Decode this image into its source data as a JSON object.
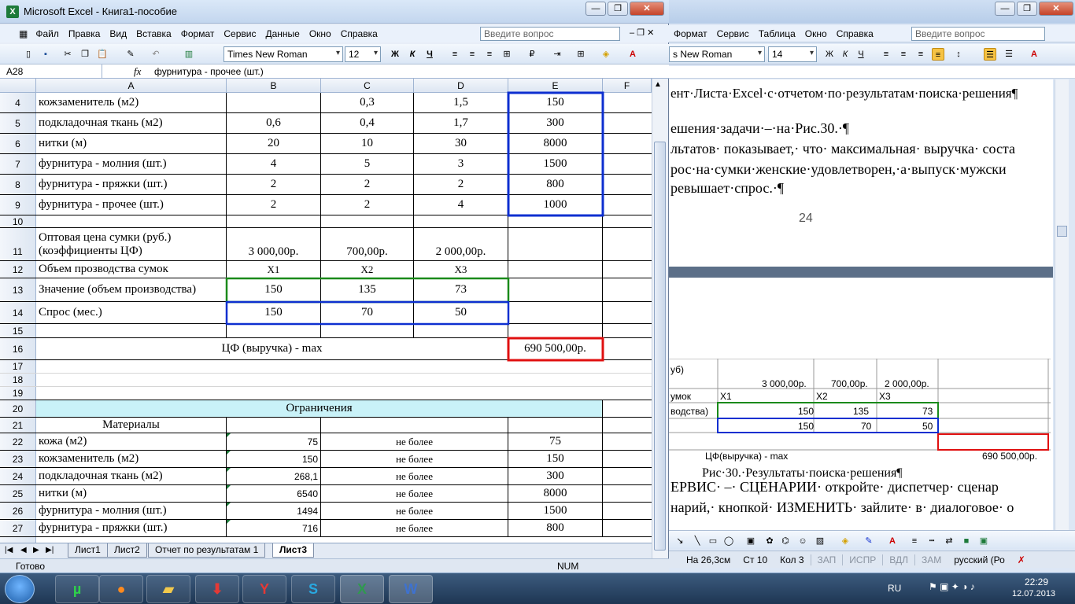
{
  "excel": {
    "title": "Microsoft Excel - Книга1-пособие",
    "menu": [
      "Файл",
      "Правка",
      "Вид",
      "Вставка",
      "Формат",
      "Сервис",
      "Данные",
      "Окно",
      "Справка"
    ],
    "ask_placeholder": "Введите вопрос",
    "font": "Times New Roman",
    "font_size": "12",
    "bold": "Ж",
    "italic": "К",
    "underline": "Ч",
    "namebox": "A28",
    "fx": "fx",
    "formula": "фурнитура - прочее (шт.)",
    "columns": [
      "A",
      "B",
      "C",
      "D",
      "E",
      "F"
    ],
    "rows": {
      "r4": {
        "n": "4",
        "a": "кожзаменитель (м2)",
        "b": "",
        "c": "0,3",
        "d": "1,5",
        "e": "150"
      },
      "r5": {
        "n": "5",
        "a": "подкладочная ткань (м2)",
        "b": "0,6",
        "c": "0,4",
        "d": "1,7",
        "e": "300"
      },
      "r6": {
        "n": "6",
        "a": "нитки (м)",
        "b": "20",
        "c": "10",
        "d": "30",
        "e": "8000"
      },
      "r7": {
        "n": "7",
        "a": "фурнитура - молния (шт.)",
        "b": "4",
        "c": "5",
        "d": "3",
        "e": "1500"
      },
      "r8": {
        "n": "8",
        "a": "фурнитура - пряжки (шт.)",
        "b": "2",
        "c": "2",
        "d": "2",
        "e": "800"
      },
      "r9": {
        "n": "9",
        "a": "фурнитура - прочее (шт.)",
        "b": "2",
        "c": "2",
        "d": "4",
        "e": "1000"
      },
      "r10": {
        "n": "10"
      },
      "r11": {
        "n": "11",
        "a1": "Оптовая цена сумки (руб.)",
        "a2": "(коэффициенты ЦФ)",
        "b": "3 000,00р.",
        "c": "700,00р.",
        "d": "2 000,00р."
      },
      "r12": {
        "n": "12",
        "a": "Объем прозводства сумок",
        "b": "X1",
        "c": "X2",
        "d": "X3"
      },
      "r13": {
        "n": "13",
        "a": "Значение (объем производства)",
        "b": "150",
        "c": "135",
        "d": "73"
      },
      "r14": {
        "n": "14",
        "a": "Спрос (мес.)",
        "b": "150",
        "c": "70",
        "d": "50"
      },
      "r15": {
        "n": "15"
      },
      "r16": {
        "n": "16",
        "label": "ЦФ (выручка) - max",
        "e": "690 500,00р."
      },
      "r17": {
        "n": "17"
      },
      "r18": {
        "n": "18"
      },
      "r19": {
        "n": "19"
      },
      "r20": {
        "n": "20",
        "label": "Ограничения"
      },
      "r21": {
        "n": "21",
        "a": "Материалы"
      },
      "r22": {
        "n": "22",
        "a": "кожа (м2)",
        "b": "75",
        "c": "не более",
        "e": "75"
      },
      "r23": {
        "n": "23",
        "a": "кожзаменитель (м2)",
        "b": "150",
        "c": "не более",
        "e": "150"
      },
      "r24": {
        "n": "24",
        "a": "подкладочная ткань (м2)",
        "b": "268,1",
        "c": "не более",
        "e": "300"
      },
      "r25": {
        "n": "25",
        "a": "нитки (м)",
        "b": "6540",
        "c": "не более",
        "e": "8000"
      },
      "r26": {
        "n": "26",
        "a": "фурнитура - молния (шт.)",
        "b": "1494",
        "c": "не более",
        "e": "1500"
      },
      "r27": {
        "n": "27",
        "a": "фурнитура - пряжки (шт.)",
        "b": "716",
        "c": "не более",
        "e": "800"
      }
    },
    "sheets": [
      "Лист1",
      "Лист2",
      "Отчет по результатам 1",
      "Лист3"
    ],
    "status": "Готово",
    "num": "NUM"
  },
  "word": {
    "menu": [
      "Формат",
      "Сервис",
      "Таблица",
      "Окно",
      "Справка"
    ],
    "ask_placeholder": "Введите вопрос",
    "font": "s New Roman",
    "font_size": "14",
    "lines": [
      "ент·Листа·Excel·с·отчетом·по·результатам·поиска·решения¶",
      "ешения·задачи·–·на·Рис.30.·¶",
      "льтатов· показывает,· что· максимальная· выручка· соста",
      "рос·на·сумки·женские·удовлетворен,·а·выпуск·мужски",
      "ревышает·спрос.·¶"
    ],
    "page_number": "24",
    "table": {
      "r1a": "уб)",
      "r2b": "3 000,00р.",
      "r2c": "700,00р.",
      "r2d": "2 000,00р.",
      "r3a": "умок",
      "r3b": "X1",
      "r3c": "X2",
      "r3d": "X3",
      "r4a": "водства)",
      "r4b": "150",
      "r4c": "135",
      "r4d": "73",
      "r5b": "150",
      "r5c": "70",
      "r5d": "50",
      "r6a": "ЦФ(выручка) - max",
      "r6e": "690 500,00р."
    },
    "caption": "Рис·30.·Результаты·поиска·решения¶",
    "line6": "ЕРВИС· –· СЦЕНАРИИ· откройте· диспетчер· сценар",
    "line7": "нарий,· кнопкой· ИЗМЕНИТЬ· зайлите· в· диалоговое· о",
    "status": {
      "pos": "На 26,3см",
      "row": "Ст 10",
      "col": "Кол 3",
      "rec": "ЗАП",
      "ispr": "ИСПР",
      "vdl": "ВДЛ",
      "zam": "ЗАМ",
      "lang": "русский (Ро"
    }
  },
  "taskbar": {
    "lang": "RU",
    "time": "22:29",
    "date": "12.07.2013"
  }
}
